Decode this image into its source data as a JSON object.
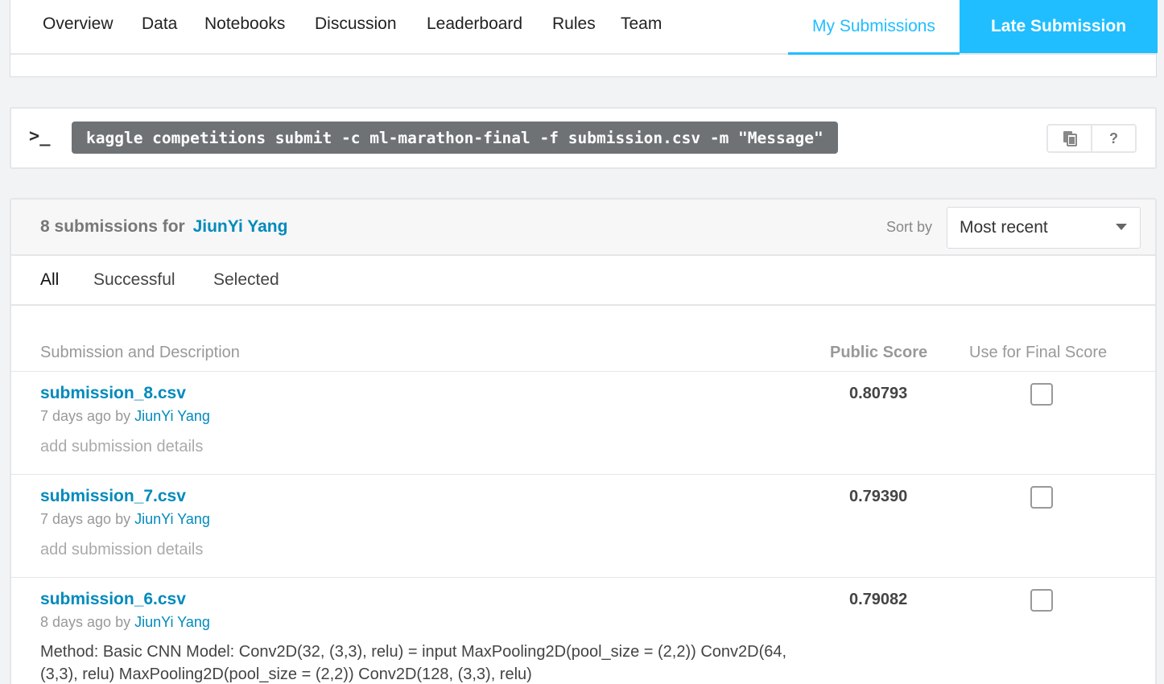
{
  "nav": {
    "tabs": [
      "Overview",
      "Data",
      "Notebooks",
      "Discussion",
      "Leaderboard",
      "Rules",
      "Team"
    ],
    "my_submissions": "My Submissions",
    "late_submission": "Late Submission"
  },
  "cli": {
    "prompt": ">_",
    "command": "kaggle competitions submit -c ml-marathon-final -f submission.csv -m \"Message\"",
    "copy_icon": "copy-icon",
    "help_label": "?"
  },
  "submissions": {
    "count_label": "8 submissions for",
    "user": "JiunYi Yang",
    "sort_label": "Sort by",
    "sort_value": "Most recent",
    "filters": [
      "All",
      "Successful",
      "Selected"
    ],
    "columns": {
      "description": "Submission and Description",
      "score": "Public Score",
      "final": "Use for Final Score"
    },
    "rows": [
      {
        "file": "submission_8.csv",
        "time": "7 days ago",
        "by": "by",
        "user": "JiunYi Yang",
        "description": "add submission details",
        "score": "0.80793",
        "selected": false
      },
      {
        "file": "submission_7.csv",
        "time": "7 days ago",
        "by": "by",
        "user": "JiunYi Yang",
        "description": "add submission details",
        "score": "0.79390",
        "selected": false
      },
      {
        "file": "submission_6.csv",
        "time": "8 days ago",
        "by": "by",
        "user": "JiunYi Yang",
        "description": "Method: Basic CNN Model: Conv2D(32, (3,3), relu) = input MaxPooling2D(pool_size = (2,2)) Conv2D(64, (3,3), relu) MaxPooling2D(pool_size = (2,2)) Conv2D(128, (3,3), relu)",
        "score": "0.79082",
        "selected": false
      }
    ]
  },
  "colors": {
    "accent": "#20beff",
    "link": "#008abc"
  }
}
